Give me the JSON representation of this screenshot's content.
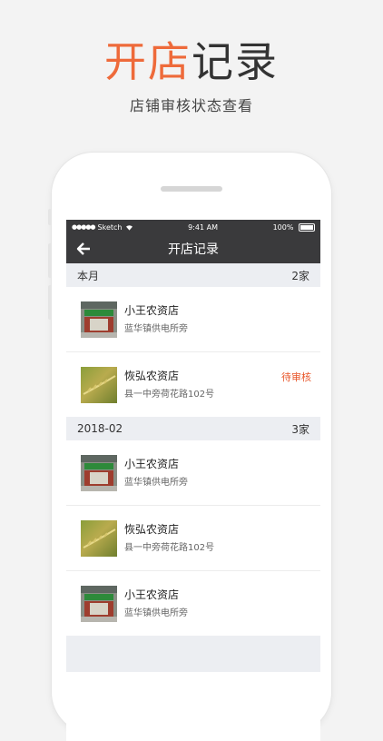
{
  "promo": {
    "title_accent": "开店",
    "title_rest": "记录",
    "subtitle": "店铺审核状态查看"
  },
  "status_bar": {
    "carrier": "Sketch",
    "time": "9:41 AM",
    "battery": "100%"
  },
  "nav": {
    "title": "开店记录",
    "back_icon": "arrow-left-icon"
  },
  "sections": [
    {
      "header": "本月",
      "count": "2家",
      "items": [
        {
          "name": "小王农资店",
          "address": "蓝华镇供电所旁",
          "status": "",
          "thumb": "storefront-photo"
        },
        {
          "name": "恢弘农资店",
          "address": "县一中旁荷花路102号",
          "status": "待审核",
          "thumb": "wheat-photo"
        }
      ]
    },
    {
      "header": "2018-02",
      "count": "3家",
      "items": [
        {
          "name": "小王农资店",
          "address": "蓝华镇供电所旁",
          "status": "",
          "thumb": "storefront-photo"
        },
        {
          "name": "恢弘农资店",
          "address": "县一中旁荷花路102号",
          "status": "",
          "thumb": "wheat-photo"
        },
        {
          "name": "小王农资店",
          "address": "蓝华镇供电所旁",
          "status": "",
          "thumb": "storefront-photo"
        }
      ]
    }
  ],
  "colors": {
    "accent": "#ee6a3a",
    "pending": "#e8562a",
    "nav_bg": "#3a3a3c",
    "section_bg": "#eceef2"
  }
}
